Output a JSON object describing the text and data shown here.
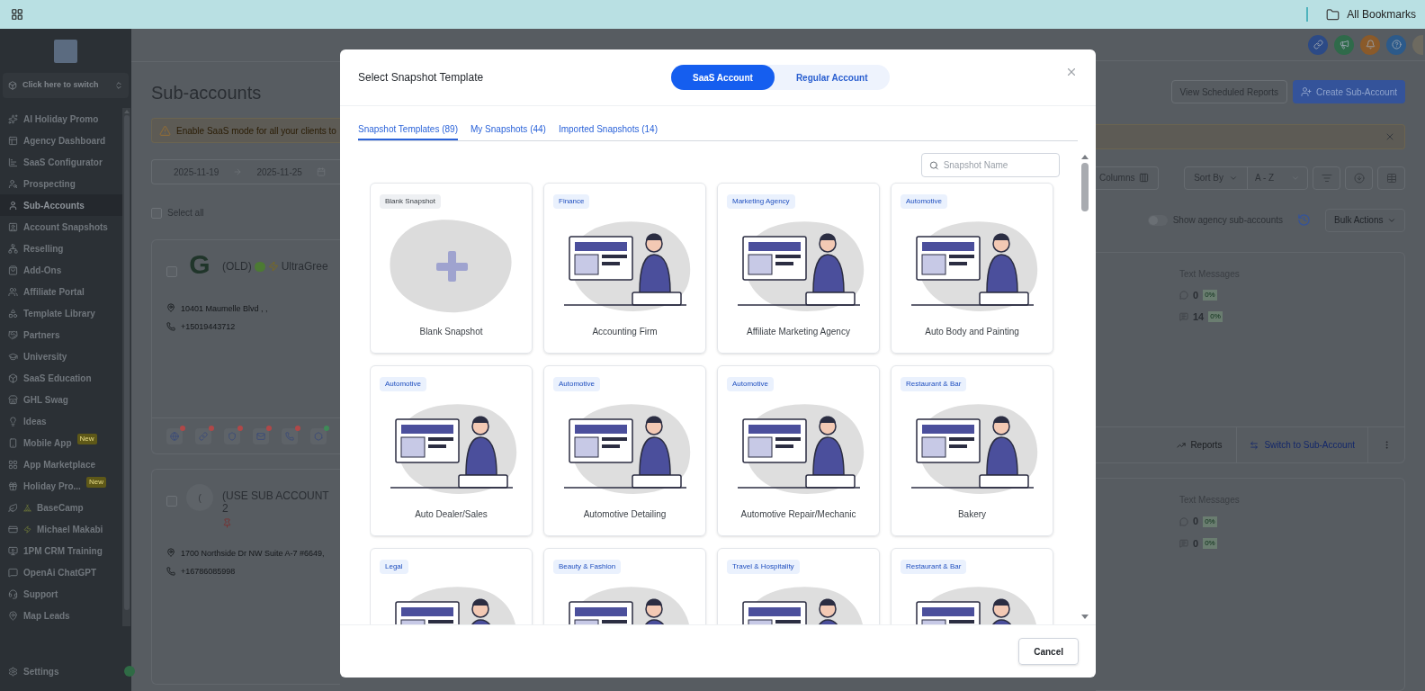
{
  "browser": {
    "bookmarks_label": "All Bookmarks"
  },
  "sidebar": {
    "switcher": "Click here to switch",
    "items": [
      {
        "label": "AI Holiday Promo",
        "selected": false
      },
      {
        "label": "Agency Dashboard",
        "selected": false
      },
      {
        "label": "SaaS Configurator",
        "selected": false
      },
      {
        "label": "Prospecting",
        "selected": false
      },
      {
        "label": "Sub-Accounts",
        "selected": true
      },
      {
        "label": "Account Snapshots",
        "selected": false
      },
      {
        "label": "Reselling",
        "selected": false
      },
      {
        "label": "Add-Ons",
        "selected": false
      },
      {
        "label": "Affiliate Portal",
        "selected": false
      },
      {
        "label": "Template Library",
        "selected": false
      },
      {
        "label": "Partners",
        "selected": false
      },
      {
        "label": "University",
        "selected": false
      },
      {
        "label": "SaaS Education",
        "selected": false
      },
      {
        "label": "GHL Swag",
        "selected": false
      },
      {
        "label": "Ideas",
        "selected": false
      },
      {
        "label": "Mobile App",
        "selected": false,
        "badge": "New"
      },
      {
        "label": "App Marketplace",
        "selected": false
      },
      {
        "label": "Holiday Pro...",
        "selected": false,
        "badge": "New"
      },
      {
        "label": "BaseCamp",
        "selected": false
      },
      {
        "label": "Michael Makabi",
        "selected": false
      },
      {
        "label": "1PM CRM Training",
        "selected": false
      },
      {
        "label": "OpenAi ChatGPT",
        "selected": false
      },
      {
        "label": "Support",
        "selected": false
      },
      {
        "label": "Map Leads",
        "selected": false
      }
    ],
    "footer": "Settings"
  },
  "page": {
    "title": "Sub-accounts",
    "header_buttons": [
      {
        "label": "View Scheduled Reports",
        "kind": "outline"
      },
      {
        "label": "Create Sub-Account",
        "kind": "primary"
      }
    ],
    "banner": "Enable SaaS mode for all your clients to",
    "date_range": {
      "start": "2025-11-19",
      "end": "2025-11-25"
    },
    "toolbar": {
      "columns": "Columns",
      "sort_label": "Sort By",
      "sort_value": "A - Z"
    },
    "select_all": {
      "label": "Select all",
      "checked": false
    },
    "show_agency": {
      "label": "Show agency sub-accounts",
      "on": false
    },
    "bulk_actions": "Bulk Actions",
    "accounts": [
      {
        "checked": false,
        "avatar": {
          "kind": "logo",
          "text": "G"
        },
        "name_parts": [
          "(OLD)",
          "UltraGree"
        ],
        "address": "10401 Maumelle Blvd , ,",
        "phone": "+15019443712",
        "text_messages": {
          "title": "Text Messages",
          "rows": [
            {
              "value": "0",
              "change": "0%"
            },
            {
              "value": "14",
              "change": "0%"
            }
          ]
        },
        "integrations": [
          {
            "color": "#b04848"
          },
          {
            "color": "#b04848"
          },
          {
            "color": "#b04848"
          },
          {
            "color": "#b04848"
          },
          {
            "color": "#b04848"
          },
          {
            "color": "#3f8a58"
          }
        ],
        "actions": {
          "reports": "Reports",
          "switch": "Switch to Sub-Account"
        }
      },
      {
        "checked": false,
        "avatar": {
          "kind": "initial",
          "text": "("
        },
        "name_parts": [
          "(USE SUB ACCOUNT 2"
        ],
        "address": "1700 Northside Dr NW Suite A-7 #6649,",
        "phone": "+16786085998",
        "text_messages": {
          "title": "Text Messages",
          "rows": [
            {
              "value": "0",
              "change": "0%"
            },
            {
              "value": "0",
              "change": "0%"
            }
          ]
        }
      }
    ]
  },
  "modal": {
    "title": "Select Snapshot Template",
    "account_types": [
      {
        "label": "SaaS Account",
        "selected": true
      },
      {
        "label": "Regular Account",
        "selected": false
      }
    ],
    "tabs": [
      {
        "label": "Snapshot Templates (89)",
        "selected": true
      },
      {
        "label": "My Snapshots (44)",
        "selected": false
      },
      {
        "label": "Imported Snapshots (14)",
        "selected": false
      }
    ],
    "search": {
      "placeholder": "Snapshot Name"
    },
    "templates": [
      {
        "kind": "blank",
        "tag": "Blank Snapshot",
        "title": "Blank Snapshot"
      },
      {
        "kind": "illustration",
        "tag": "Finance",
        "title": "Accounting Firm"
      },
      {
        "kind": "illustration",
        "tag": "Marketing Agency",
        "title": "Affiliate Marketing Agency"
      },
      {
        "kind": "illustration",
        "tag": "Automotive",
        "title": "Auto Body and Painting"
      },
      {
        "kind": "illustration",
        "tag": "Automotive",
        "title": "Auto Dealer/Sales"
      },
      {
        "kind": "illustration",
        "tag": "Automotive",
        "title": "Automotive Detailing"
      },
      {
        "kind": "illustration",
        "tag": "Automotive",
        "title": "Automotive Repair/Mechanic"
      },
      {
        "kind": "illustration",
        "tag": "Restaurant & Bar",
        "title": "Bakery"
      },
      {
        "kind": "illustration",
        "tag": "Legal"
      },
      {
        "kind": "illustration",
        "tag": "Beauty & Fashion"
      },
      {
        "kind": "illustration",
        "tag": "Travel & Hospitality"
      },
      {
        "kind": "illustration",
        "tag": "Restaurant & Bar"
      }
    ],
    "cancel": "Cancel"
  }
}
